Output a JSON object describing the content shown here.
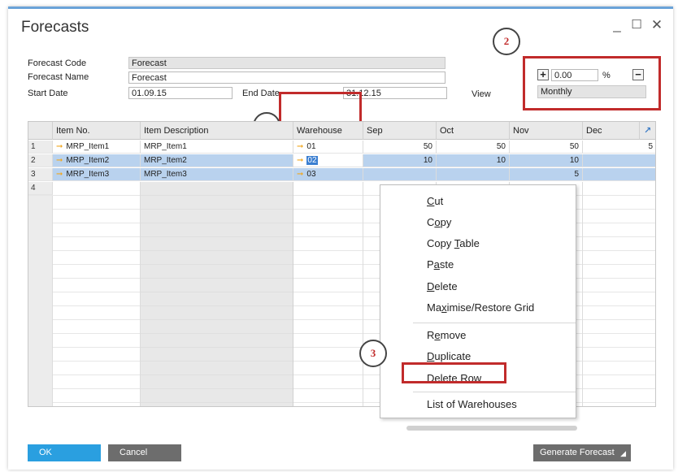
{
  "window": {
    "title": "Forecasts"
  },
  "header": {
    "forecast_code_label": "Forecast Code",
    "forecast_code_value": "Forecast",
    "forecast_name_label": "Forecast Name",
    "forecast_name_value": "Forecast",
    "start_date_label": "Start Date",
    "start_date_value": "01.09.15",
    "end_date_label": "End Date",
    "end_date_value": "31.12.15",
    "view_label": "View",
    "view_value": "Monthly",
    "percent_value": "0.00",
    "percent_sign": "%"
  },
  "annotations": {
    "c1": "1",
    "c2": "2",
    "c3": "3"
  },
  "grid": {
    "columns": [
      "",
      "Item No.",
      "Item Description",
      "Warehouse",
      "Sep",
      "Oct",
      "Nov",
      "Dec"
    ],
    "rows": [
      {
        "num": "1",
        "item": "MRP_Item1",
        "desc": "MRP_Item1",
        "wh": "01",
        "sep": "50",
        "oct": "50",
        "nov": "50",
        "dec": "5"
      },
      {
        "num": "2",
        "item": "MRP_Item2",
        "desc": "MRP_Item2",
        "wh": "02",
        "sep": "10",
        "oct": "10",
        "nov": "10",
        "dec": ""
      },
      {
        "num": "3",
        "item": "MRP_Item3",
        "desc": "MRP_Item3",
        "wh": "03",
        "sep": "",
        "oct": "",
        "nov": "5",
        "dec": ""
      },
      {
        "num": "4",
        "item": "",
        "desc": "",
        "wh": "",
        "sep": "",
        "oct": "",
        "nov": "",
        "dec": ""
      }
    ]
  },
  "context_menu": {
    "items": [
      "Cut",
      "Copy",
      "Copy Table",
      "Paste",
      "Delete",
      "Maximise/Restore Grid",
      "Remove",
      "Duplicate",
      "Delete Row",
      "List of Warehouses"
    ]
  },
  "footer": {
    "ok": "OK",
    "cancel": "Cancel",
    "generate": "Generate Forecast"
  },
  "colors": {
    "accent": "#6aa3d8",
    "highlight": "#c12b2b",
    "selection": "#b9d2ee",
    "ok_button": "#2a9fe0",
    "dark_button": "#6d6d6d"
  }
}
